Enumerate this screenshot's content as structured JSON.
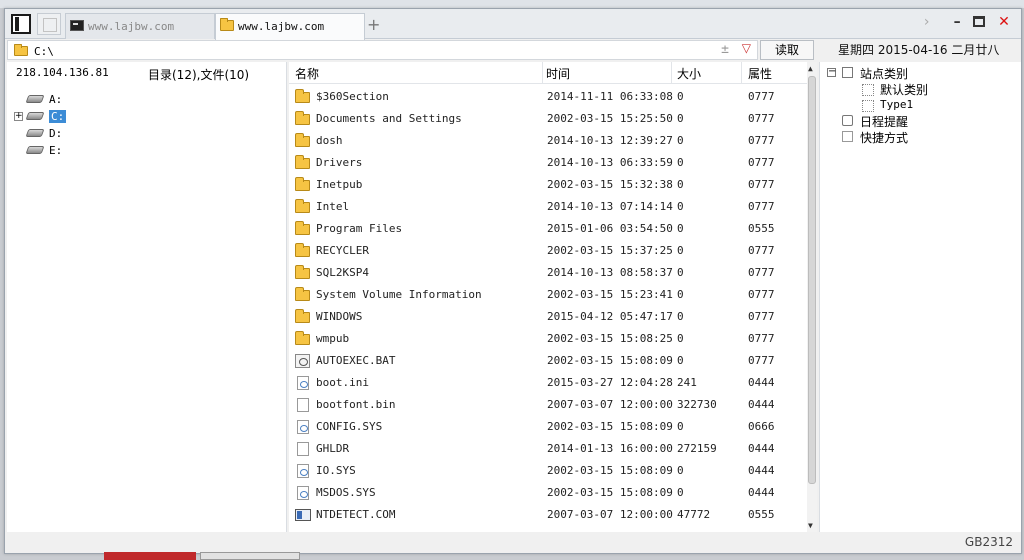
{
  "tabs": [
    {
      "label": "www.lajbw.com",
      "icon": "terminal-icon",
      "active": false
    },
    {
      "label": "www.lajbw.com",
      "icon": "folder-icon",
      "active": true
    }
  ],
  "tabbar": {
    "new_tab": "+"
  },
  "address": {
    "path": "C:\\",
    "read_button": "读取",
    "dropdown": "▽",
    "plusminus": "±"
  },
  "date": {
    "text": "星期四 2015-04-16 二月廿八"
  },
  "left_pane": {
    "ip": "218.104.136.81",
    "counts": "目录(12),文件(10)",
    "drives": [
      {
        "label": "A:",
        "selected": false
      },
      {
        "label": "C:",
        "selected": true
      },
      {
        "label": "D:",
        "selected": false
      },
      {
        "label": "E:",
        "selected": false
      }
    ]
  },
  "file_pane": {
    "columns": {
      "name": "名称",
      "time": "时间",
      "size": "大小",
      "attr": "属性"
    },
    "rows": [
      {
        "name": "$360Section",
        "time": "2014-11-11 06:33:08",
        "size": "0",
        "attr": "0777",
        "icon": "folder-icon"
      },
      {
        "name": "Documents and Settings",
        "time": "2002-03-15 15:25:50",
        "size": "0",
        "attr": "0777",
        "icon": "folder-icon"
      },
      {
        "name": "dosh",
        "time": "2014-10-13 12:39:27",
        "size": "0",
        "attr": "0777",
        "icon": "folder-icon"
      },
      {
        "name": "Drivers",
        "time": "2014-10-13 06:33:59",
        "size": "0",
        "attr": "0777",
        "icon": "folder-icon"
      },
      {
        "name": "Inetpub",
        "time": "2002-03-15 15:32:38",
        "size": "0",
        "attr": "0777",
        "icon": "folder-icon"
      },
      {
        "name": "Intel",
        "time": "2014-10-13 07:14:14",
        "size": "0",
        "attr": "0777",
        "icon": "folder-icon"
      },
      {
        "name": "Program Files",
        "time": "2015-01-06 03:54:50",
        "size": "0",
        "attr": "0555",
        "icon": "folder-icon"
      },
      {
        "name": "RECYCLER",
        "time": "2002-03-15 15:37:25",
        "size": "0",
        "attr": "0777",
        "icon": "folder-icon"
      },
      {
        "name": "SQL2KSP4",
        "time": "2014-10-13 08:58:37",
        "size": "0",
        "attr": "0777",
        "icon": "folder-icon"
      },
      {
        "name": "System Volume Information",
        "time": "2002-03-15 15:23:41",
        "size": "0",
        "attr": "0777",
        "icon": "folder-icon"
      },
      {
        "name": "WINDOWS",
        "time": "2015-04-12 05:47:17",
        "size": "0",
        "attr": "0777",
        "icon": "folder-icon"
      },
      {
        "name": "wmpub",
        "time": "2002-03-15 15:08:25",
        "size": "0",
        "attr": "0777",
        "icon": "folder-icon"
      },
      {
        "name": "AUTOEXEC.BAT",
        "time": "2002-03-15 15:08:09",
        "size": "0",
        "attr": "0777",
        "icon": "batch-file-icon"
      },
      {
        "name": "boot.ini",
        "time": "2015-03-27 12:04:28",
        "size": "241",
        "attr": "0444",
        "icon": "config-file-icon"
      },
      {
        "name": "bootfont.bin",
        "time": "2007-03-07 12:00:00",
        "size": "322730",
        "attr": "0444",
        "icon": "file-icon"
      },
      {
        "name": "CONFIG.SYS",
        "time": "2002-03-15 15:08:09",
        "size": "0",
        "attr": "0666",
        "icon": "system-file-icon"
      },
      {
        "name": "GHLDR",
        "time": "2014-01-13 16:00:00",
        "size": "272159",
        "attr": "0444",
        "icon": "file-icon"
      },
      {
        "name": "IO.SYS",
        "time": "2002-03-15 15:08:09",
        "size": "0",
        "attr": "0444",
        "icon": "system-file-icon"
      },
      {
        "name": "MSDOS.SYS",
        "time": "2002-03-15 15:08:09",
        "size": "0",
        "attr": "0444",
        "icon": "system-file-icon"
      },
      {
        "name": "NTDETECT.COM",
        "time": "2007-03-07 12:00:00",
        "size": "47772",
        "attr": "0555",
        "icon": "executable-file-icon"
      }
    ]
  },
  "right_pane": {
    "site_category": "站点类别",
    "default_category": "默认类别",
    "type1": "Type1",
    "schedule": "日程提醒",
    "shortcuts": "快捷方式"
  },
  "status": {
    "encoding": "GB2312"
  }
}
